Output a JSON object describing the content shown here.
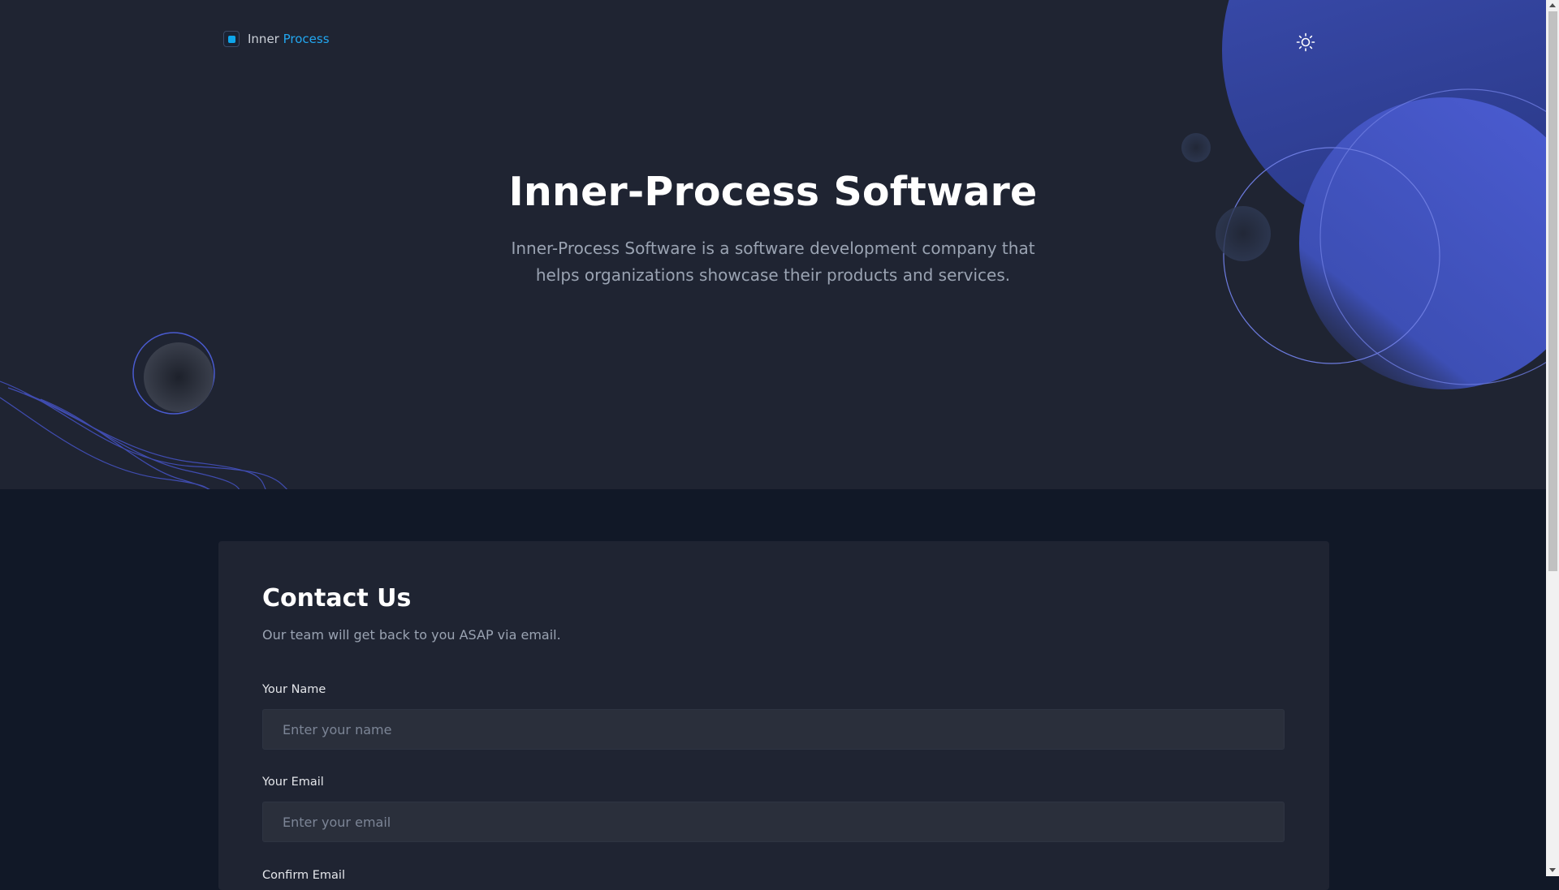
{
  "header": {
    "logo_inner": "Inner",
    "logo_process": "Process",
    "theme_icon": "sun-icon"
  },
  "hero": {
    "title": "Inner-Process Software",
    "subtitle": "Inner-Process Software is a software development company that helps organizations showcase their products and services."
  },
  "contact": {
    "title": "Contact Us",
    "subtitle": "Our team will get back to you ASAP via email.",
    "fields": [
      {
        "label": "Your Name",
        "placeholder": "Enter your name"
      },
      {
        "label": "Your Email",
        "placeholder": "Enter your email"
      },
      {
        "label": "Confirm Email"
      }
    ]
  },
  "colors": {
    "accent": "#22a7f0",
    "hero_bg": "#1f2432",
    "page_bg": "#111827",
    "deco_blue": "#3d4fb5"
  }
}
